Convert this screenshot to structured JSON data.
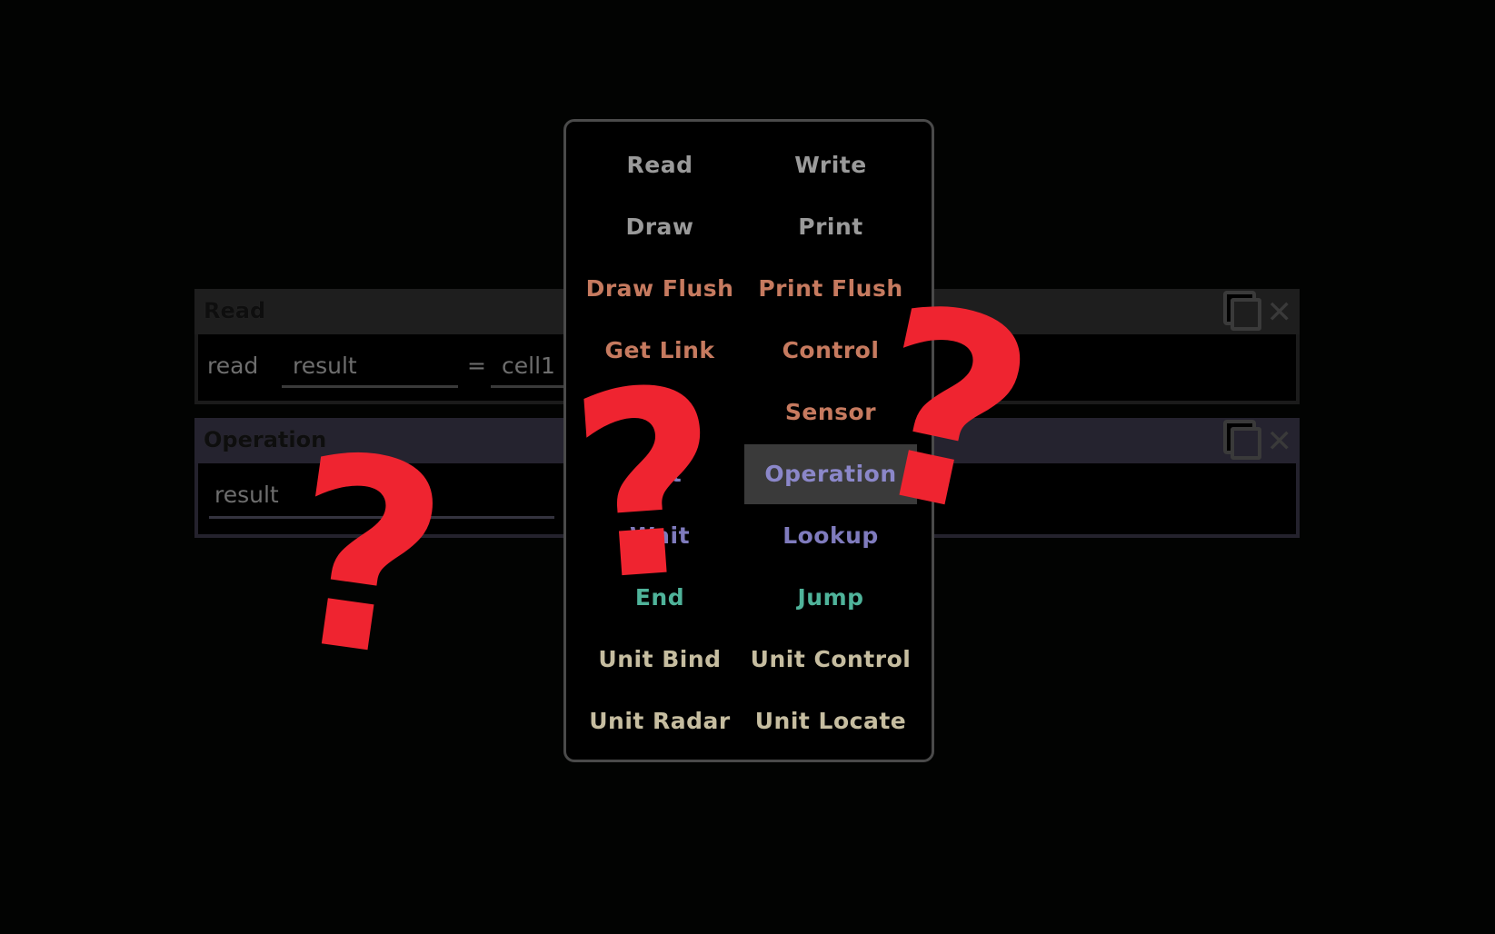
{
  "blocks": [
    {
      "title": "Read",
      "keyword": "read",
      "output": "result",
      "equals": "=",
      "source": "cell1",
      "header_color": "#1e1e1e"
    },
    {
      "title": "Operation",
      "output": "result",
      "header_color": "#25232f"
    }
  ],
  "menu": {
    "items": [
      {
        "label": "Read",
        "color": "#9a9a9a"
      },
      {
        "label": "Write",
        "color": "#9a9a9a"
      },
      {
        "label": "Draw",
        "color": "#9a9a9a"
      },
      {
        "label": "Print",
        "color": "#9a9a9a"
      },
      {
        "label": "Draw Flush",
        "color": "#c67a5f"
      },
      {
        "label": "Print Flush",
        "color": "#c67a5f"
      },
      {
        "label": "Get Link",
        "color": "#c67a5f"
      },
      {
        "label": "Control",
        "color": "#c67a5f"
      },
      {
        "label": "",
        "color": "#c67a5f"
      },
      {
        "label": "Sensor",
        "color": "#c67a5f"
      },
      {
        "label": "Set",
        "color": "#7f7bbd"
      },
      {
        "label": "Operation",
        "color": "#8b87c9",
        "selected": true
      },
      {
        "label": "Wait",
        "color": "#7f7bbd"
      },
      {
        "label": "Lookup",
        "color": "#7f7bbd"
      },
      {
        "label": "End",
        "color": "#4fb39a"
      },
      {
        "label": "Jump",
        "color": "#4fb39a"
      },
      {
        "label": "Unit Bind",
        "color": "#c6bda0"
      },
      {
        "label": "Unit Control",
        "color": "#c6bda0"
      },
      {
        "label": "Unit Radar",
        "color": "#c6bda0"
      },
      {
        "label": "Unit Locate",
        "color": "#c6bda0"
      }
    ]
  },
  "overlay": {
    "mark": "?",
    "color": "#ef2430"
  }
}
